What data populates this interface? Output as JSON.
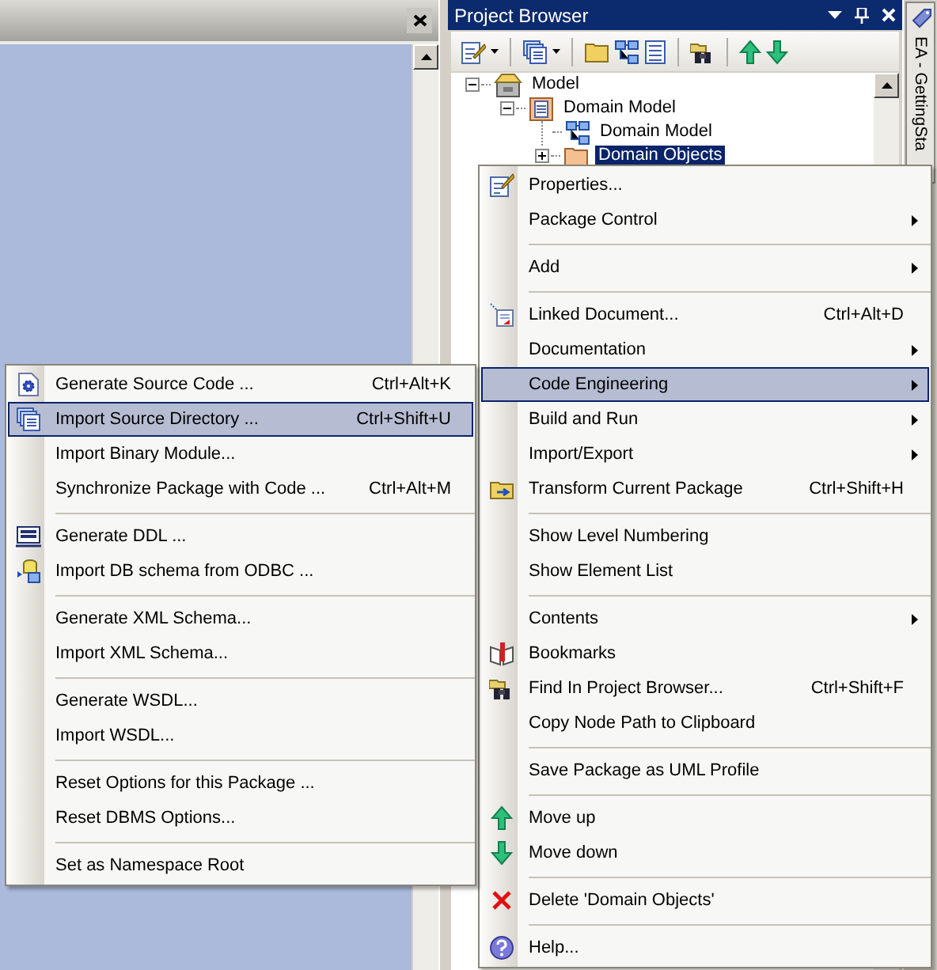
{
  "project_browser": {
    "title": "Project Browser",
    "tree": [
      {
        "kind": "model",
        "label": "Model",
        "expanded": true,
        "selected": false,
        "children": [
          {
            "kind": "package",
            "label": "Domain Model",
            "expanded": true,
            "selected": false,
            "children": [
              {
                "kind": "diagram",
                "label": "Domain Model",
                "selected": false
              },
              {
                "kind": "folder",
                "label": "Domain Objects",
                "expanded": false,
                "selected": true
              }
            ]
          }
        ]
      }
    ]
  },
  "side_tab": {
    "label": "EA - GettingSta"
  },
  "context_menu": {
    "items": [
      {
        "kind": "item",
        "label": "Properties...",
        "has_submenu": false,
        "selected": false
      },
      {
        "kind": "item",
        "label": "Package Control",
        "has_submenu": true,
        "selected": false
      },
      {
        "kind": "separator"
      },
      {
        "kind": "item",
        "label": "Add",
        "has_submenu": true,
        "selected": false
      },
      {
        "kind": "separator"
      },
      {
        "kind": "item",
        "label": "Linked Document...",
        "shortcut": "Ctrl+Alt+D",
        "has_submenu": false,
        "selected": false
      },
      {
        "kind": "item",
        "label": "Documentation",
        "has_submenu": true,
        "selected": false
      },
      {
        "kind": "item",
        "label": "Code Engineering",
        "has_submenu": true,
        "selected": true
      },
      {
        "kind": "item",
        "label": "Build and Run",
        "has_submenu": true,
        "selected": false
      },
      {
        "kind": "item",
        "label": "Import/Export",
        "has_submenu": true,
        "selected": false
      },
      {
        "kind": "item",
        "label": "Transform Current Package",
        "shortcut": "Ctrl+Shift+H",
        "has_submenu": false,
        "selected": false
      },
      {
        "kind": "separator"
      },
      {
        "kind": "item",
        "label": "Show Level Numbering",
        "has_submenu": false,
        "selected": false
      },
      {
        "kind": "item",
        "label": "Show Element List",
        "has_submenu": false,
        "selected": false
      },
      {
        "kind": "separator"
      },
      {
        "kind": "item",
        "label": "Contents",
        "has_submenu": true,
        "selected": false
      },
      {
        "kind": "item",
        "label": "Bookmarks",
        "has_submenu": false,
        "selected": false
      },
      {
        "kind": "item",
        "label": "Find In Project Browser...",
        "shortcut": "Ctrl+Shift+F",
        "has_submenu": false,
        "selected": false
      },
      {
        "kind": "item",
        "label": "Copy Node Path to Clipboard",
        "has_submenu": false,
        "selected": false
      },
      {
        "kind": "separator"
      },
      {
        "kind": "item",
        "label": "Save Package as UML Profile",
        "has_submenu": false,
        "selected": false
      },
      {
        "kind": "separator"
      },
      {
        "kind": "item",
        "label": "Move up",
        "has_submenu": false,
        "selected": false
      },
      {
        "kind": "item",
        "label": "Move down",
        "has_submenu": false,
        "selected": false
      },
      {
        "kind": "separator"
      },
      {
        "kind": "item",
        "label": "Delete 'Domain Objects'",
        "has_submenu": false,
        "selected": false
      },
      {
        "kind": "separator"
      },
      {
        "kind": "item",
        "label": "Help...",
        "has_submenu": false,
        "selected": false
      }
    ]
  },
  "submenu": {
    "items": [
      {
        "kind": "item",
        "label": "Generate Source Code ...",
        "shortcut": "Ctrl+Alt+K",
        "selected": false
      },
      {
        "kind": "item",
        "label": "Import Source Directory ...",
        "shortcut": "Ctrl+Shift+U",
        "selected": true
      },
      {
        "kind": "item",
        "label": "Import Binary Module...",
        "selected": false
      },
      {
        "kind": "item",
        "label": "Synchronize Package with Code ...",
        "shortcut": "Ctrl+Alt+M",
        "selected": false
      },
      {
        "kind": "separator"
      },
      {
        "kind": "item",
        "label": "Generate DDL ...",
        "selected": false
      },
      {
        "kind": "item",
        "label": "Import DB schema from ODBC ...",
        "selected": false
      },
      {
        "kind": "separator"
      },
      {
        "kind": "item",
        "label": "Generate XML Schema...",
        "selected": false
      },
      {
        "kind": "item",
        "label": "Import XML Schema...",
        "selected": false
      },
      {
        "kind": "separator"
      },
      {
        "kind": "item",
        "label": "Generate WSDL...",
        "selected": false
      },
      {
        "kind": "item",
        "label": "Import WSDL...",
        "selected": false
      },
      {
        "kind": "separator"
      },
      {
        "kind": "item",
        "label": "Reset Options for this Package ...",
        "selected": false
      },
      {
        "kind": "item",
        "label": "Reset DBMS Options...",
        "selected": false
      },
      {
        "kind": "separator"
      },
      {
        "kind": "item",
        "label": "Set as Namespace Root",
        "selected": false
      }
    ]
  }
}
